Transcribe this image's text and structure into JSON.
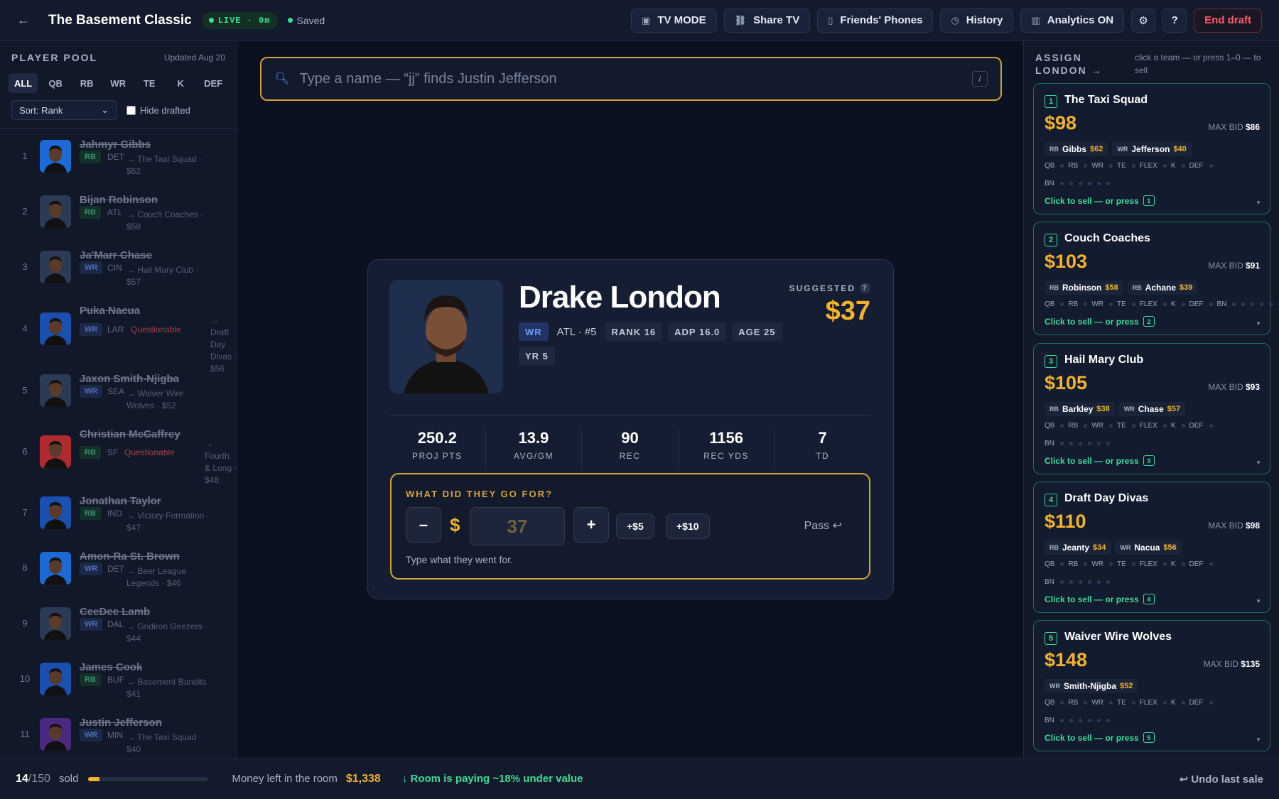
{
  "topbar": {
    "back": "←",
    "title": "The Basement Classic",
    "live": "LIVE · 0m",
    "saved": "Saved",
    "buttons": {
      "tv": "TV MODE",
      "share": "Share TV",
      "phones": "Friends' Phones",
      "history": "History",
      "analytics": "Analytics ON",
      "help": "?",
      "end": "End draft"
    }
  },
  "pool": {
    "title": "PLAYER POOL",
    "updated": "Updated Aug 20",
    "filters": [
      "ALL",
      "QB",
      "RB",
      "WR",
      "TE",
      "K",
      "DEF"
    ],
    "sort": "Sort: Rank",
    "hide_drafted": "Hide drafted",
    "players": [
      {
        "rank": "1",
        "name": "Jahmyr Gibbs",
        "pos": "RB",
        "team": "DET",
        "status": "",
        "dest1": "→ The Taxi Squad ·",
        "dest2": "$62",
        "dest3": "",
        "dest4": ""
      },
      {
        "rank": "2",
        "name": "Bijan Robinson",
        "pos": "RB",
        "team": "ATL",
        "status": "",
        "dest1": "→ Couch Coaches ·",
        "dest2": "$58",
        "dest3": "",
        "dest4": ""
      },
      {
        "rank": "3",
        "name": "Ja'Marr Chase",
        "pos": "WR",
        "team": "CIN",
        "status": "",
        "dest1": "→ Hail Mary Club ·",
        "dest2": "$57",
        "dest3": "",
        "dest4": ""
      },
      {
        "rank": "4",
        "name": "Puka Nacua",
        "pos": "WR",
        "team": "LAR",
        "status": "Questionable",
        "dest1": "→ Draft",
        "dest2": "Day",
        "dest3": "Divas ·",
        "dest4": "$56"
      },
      {
        "rank": "5",
        "name": "Jaxon Smith-Njigba",
        "pos": "WR",
        "team": "SEA",
        "status": "",
        "dest1": "→ Waiver Wire",
        "dest2": "Wolves · $52",
        "dest3": "",
        "dest4": ""
      },
      {
        "rank": "6",
        "name": "Christian McCaffrey",
        "pos": "RB",
        "team": "SF",
        "status": "Questionable",
        "dest1": "→ Fourth",
        "dest2": "& Long ·",
        "dest3": "$48",
        "dest4": ""
      },
      {
        "rank": "7",
        "name": "Jonathan Taylor",
        "pos": "RB",
        "team": "IND",
        "status": "",
        "dest1": "→ Victory Formation ·",
        "dest2": "$47",
        "dest3": "",
        "dest4": ""
      },
      {
        "rank": "8",
        "name": "Amon-Ra St. Brown",
        "pos": "WR",
        "team": "DET",
        "status": "",
        "dest1": "→ Beer League",
        "dest2": "Legends · $46",
        "dest3": "",
        "dest4": ""
      },
      {
        "rank": "9",
        "name": "CeeDee Lamb",
        "pos": "WR",
        "team": "DAL",
        "status": "",
        "dest1": "→ Gridiron Geezers ·",
        "dest2": "$44",
        "dest3": "",
        "dest4": ""
      },
      {
        "rank": "10",
        "name": "James Cook",
        "pos": "RB",
        "team": "BUF",
        "status": "",
        "dest1": "→ Basement Bandits ·",
        "dest2": "$41",
        "dest3": "",
        "dest4": ""
      },
      {
        "rank": "11",
        "name": "Justin Jefferson",
        "pos": "WR",
        "team": "MIN",
        "status": "",
        "dest1": "→ The Taxi Squad ·",
        "dest2": "$40",
        "dest3": "",
        "dest4": ""
      }
    ]
  },
  "search": {
    "placeholder": "Type a name — “jj” finds Justin Jefferson",
    "shortcut": "/"
  },
  "player": {
    "name": "Drake London",
    "suggested_label": "SUGGESTED",
    "suggested": "$37",
    "pos": "WR",
    "team_rank": "ATL · #5",
    "rank": "RANK 16",
    "adp": "ADP 16.0",
    "age": "AGE 25",
    "yr": "YR 5",
    "stats": [
      {
        "n": "250.2",
        "k": "PROJ PTS"
      },
      {
        "n": "13.9",
        "k": "AVG/GM"
      },
      {
        "n": "90",
        "k": "REC"
      },
      {
        "n": "1156",
        "k": "REC YDS"
      },
      {
        "n": "7",
        "k": "TD"
      }
    ]
  },
  "bid": {
    "heading": "WHAT DID THEY GO FOR?",
    "minus": "–",
    "dollar": "$",
    "value": "37",
    "plus": "+",
    "inc5": "+$5",
    "inc10": "+$10",
    "pass": "Pass ↩",
    "hint": "Type what they went for."
  },
  "assign": {
    "title": "ASSIGN LONDON →",
    "sub": "click a team — or press 1–0 — to sell",
    "teams": [
      {
        "num": "1",
        "name": "The Taxi Squad",
        "budget": "$98",
        "max_label": "MAX BID",
        "max": "$86",
        "picks": [
          {
            "p": "RB",
            "n": "Gibbs",
            "v": "$62"
          },
          {
            "p": "WR",
            "n": "Jefferson",
            "v": "$40"
          }
        ],
        "sell": "Click to sell — or press"
      },
      {
        "num": "2",
        "name": "Couch Coaches",
        "budget": "$103",
        "max_label": "MAX BID",
        "max": "$91",
        "picks": [
          {
            "p": "RB",
            "n": "Robinson",
            "v": "$58"
          },
          {
            "p": "RB",
            "n": "Achane",
            "v": "$39"
          }
        ],
        "sell": "Click to sell — or press"
      },
      {
        "num": "3",
        "name": "Hail Mary Club",
        "budget": "$105",
        "max_label": "MAX BID",
        "max": "$93",
        "picks": [
          {
            "p": "RB",
            "n": "Barkley",
            "v": "$38"
          },
          {
            "p": "WR",
            "n": "Chase",
            "v": "$57"
          }
        ],
        "sell": "Click to sell — or press"
      },
      {
        "num": "4",
        "name": "Draft Day Divas",
        "budget": "$110",
        "max_label": "MAX BID",
        "max": "$98",
        "picks": [
          {
            "p": "RB",
            "n": "Jeanty",
            "v": "$34"
          },
          {
            "p": "WR",
            "n": "Nacua",
            "v": "$56"
          }
        ],
        "sell": "Click to sell — or press"
      },
      {
        "num": "5",
        "name": "Waiver Wire Wolves",
        "budget": "$148",
        "max_label": "MAX BID",
        "max": "$135",
        "picks": [
          {
            "p": "WR",
            "n": "Smith-Njigba",
            "v": "$52"
          }
        ],
        "sell": "Click to sell — or press"
      }
    ],
    "slot_labels": {
      "qb": "QB",
      "rb": "RB",
      "wr": "WR",
      "te": "TE",
      "flex": "FLEX",
      "k": "K",
      "def": "DEF",
      "bn": "BN"
    }
  },
  "bottom": {
    "sold_count": "14",
    "sold_total": "/150",
    "sold_label": "sold",
    "sold_fraction": 0.093,
    "money_label": "Money left in the room",
    "money": "$1,338",
    "under": "↓ Room is paying ~18% under value",
    "undo": "↩ Undo last sale"
  }
}
